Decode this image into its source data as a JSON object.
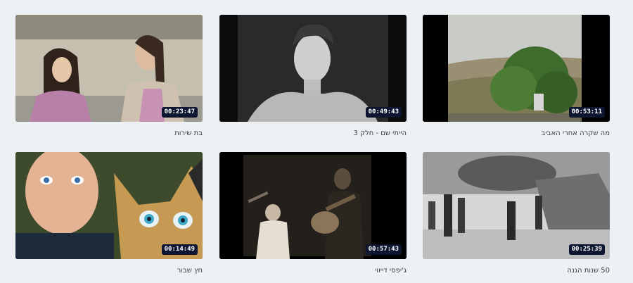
{
  "videos": [
    {
      "title": "מה שקרה אחרי האביב",
      "duration": "00:53:11"
    },
    {
      "title": "הייתי שם - חלק 3",
      "duration": "00:49:43"
    },
    {
      "title": "בת שירות",
      "duration": "00:23:47"
    },
    {
      "title": "50 שנות הגנה",
      "duration": "00:25:39"
    },
    {
      "title": "ג'יפסי דייווי",
      "duration": "00:57:43"
    },
    {
      "title": "חץ שבור",
      "duration": "00:14:49"
    }
  ]
}
